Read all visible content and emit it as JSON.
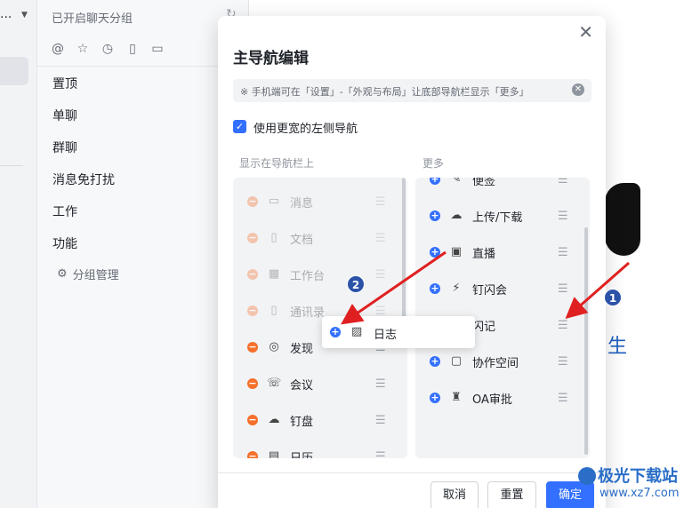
{
  "rail": {
    "menu_dots": "..."
  },
  "groups": {
    "header": "已开启聊天分组",
    "items": [
      "置顶",
      "单聊",
      "群聊",
      "消息免打扰",
      "工作",
      "功能"
    ],
    "manage": "分组管理"
  },
  "background": {
    "partial_text": "生"
  },
  "modal": {
    "title": "主导航编辑",
    "tip": "※ 手机端可在「设置」-「外观与布局」让底部导航栏显示「更多」",
    "checkbox_label": "使用更宽的左侧导航",
    "checkbox_checked": true,
    "left_label": "显示在导航栏上",
    "right_label": "更多",
    "left_items": [
      {
        "label": "消息",
        "icon": "chat-icon",
        "glyph": "▭",
        "dim": true
      },
      {
        "label": "文档",
        "icon": "document-icon",
        "glyph": "▯",
        "dim": true
      },
      {
        "label": "工作台",
        "icon": "grid-icon",
        "glyph": "▦",
        "dim": true
      },
      {
        "label": "通讯录",
        "icon": "contacts-icon",
        "glyph": "▯",
        "dim": true
      },
      {
        "label": "发现",
        "icon": "compass-icon",
        "glyph": "◎",
        "dim": false
      },
      {
        "label": "会议",
        "icon": "video-call-icon",
        "glyph": "☏",
        "dim": false
      },
      {
        "label": "钉盘",
        "icon": "cloud-drive-icon",
        "glyph": "☁",
        "dim": false
      },
      {
        "label": "日历",
        "icon": "calendar-icon",
        "glyph": "▤",
        "dim": false
      }
    ],
    "right_items": [
      {
        "label": "便签",
        "icon": "note-icon",
        "glyph": "✎"
      },
      {
        "label": "上传/下载",
        "icon": "cloud-transfer-icon",
        "glyph": "☁"
      },
      {
        "label": "直播",
        "icon": "live-tv-icon",
        "glyph": "▣"
      },
      {
        "label": "钉闪会",
        "icon": "flash-meeting-icon",
        "glyph": "⚡"
      },
      {
        "label": "闪记",
        "icon": "voice-note-icon",
        "glyph": "♪"
      },
      {
        "label": "协作空间",
        "icon": "workspace-icon",
        "glyph": "▢"
      },
      {
        "label": "OA审批",
        "icon": "approval-stamp-icon",
        "glyph": "♜"
      }
    ],
    "dragging_item": {
      "label": "日志",
      "icon": "log-icon",
      "glyph": "▨"
    },
    "buttons": {
      "cancel": "取消",
      "reset": "重置",
      "confirm": "确定"
    }
  },
  "annotations": [
    "1",
    "2"
  ],
  "watermark": {
    "text": "极光下载站",
    "url": "www.xz7.com"
  },
  "colors": {
    "accent": "#3370ff",
    "remove": "#f5702b",
    "annotation": "#e02020"
  }
}
